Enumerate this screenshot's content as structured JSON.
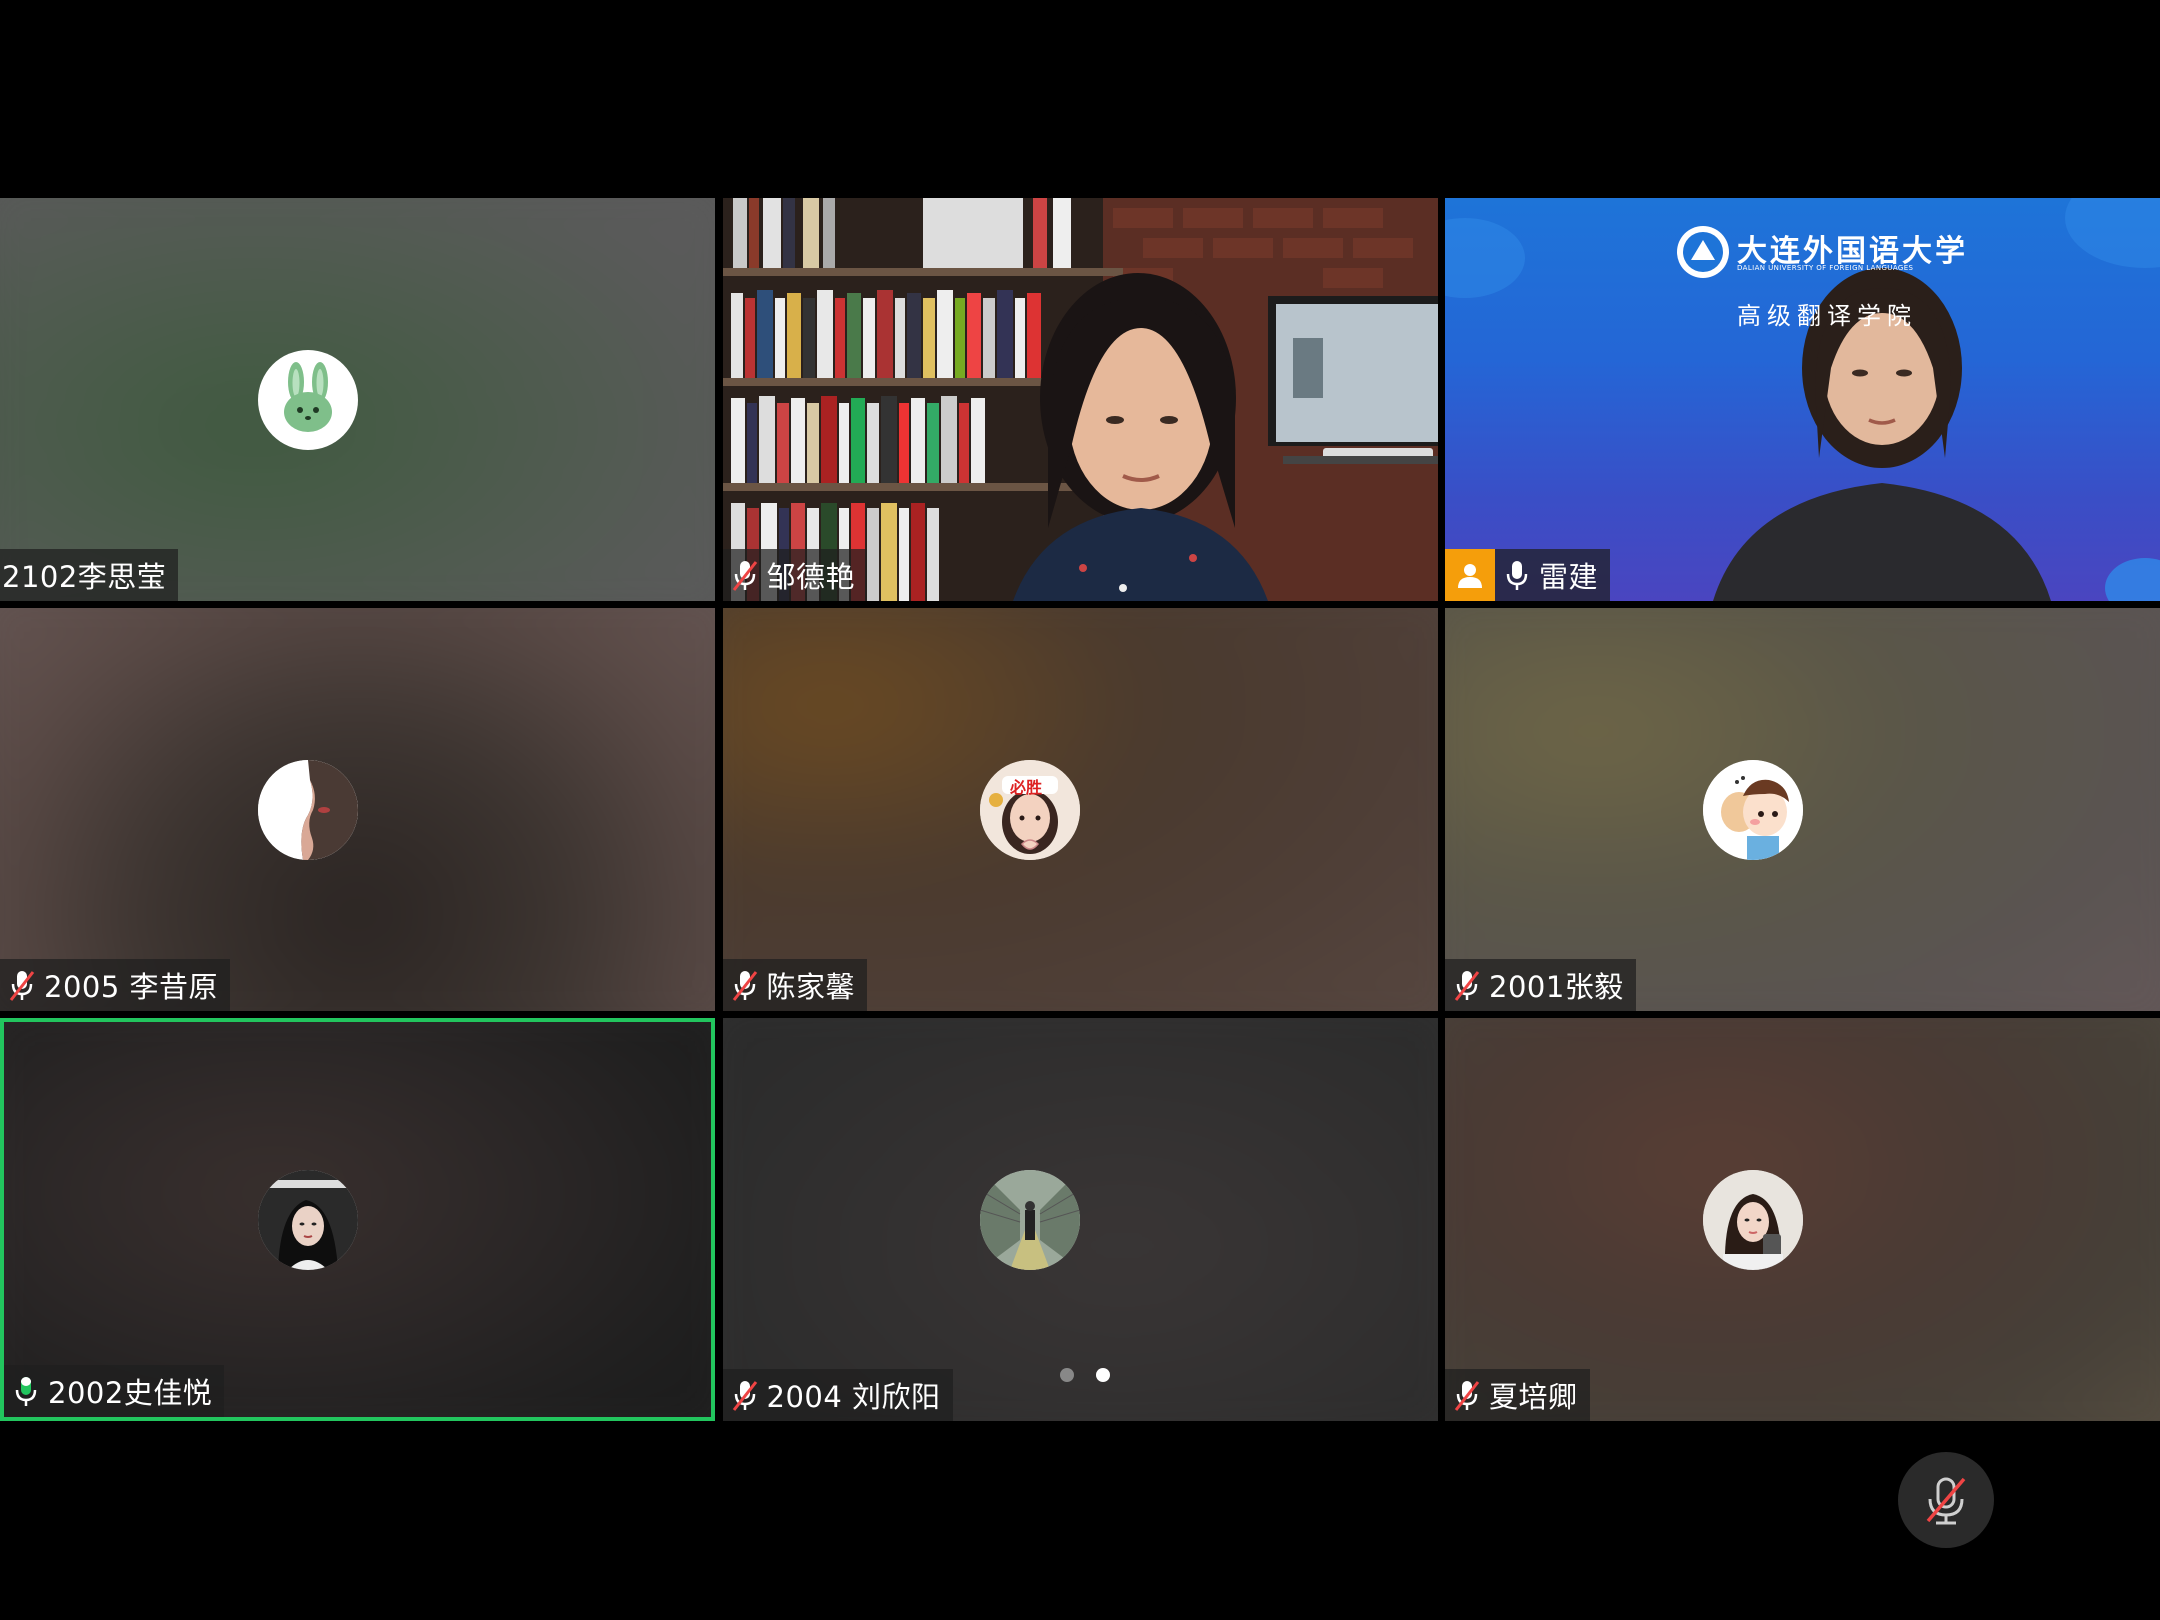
{
  "colors": {
    "active_speaker_border": "#22c55e",
    "host_badge": "#f59e0b",
    "muted_slash": "#ef4444"
  },
  "participants": [
    {
      "name": "2102李思莹",
      "mic": "none",
      "avatar": "rabbit-avatar"
    },
    {
      "name": "邹德艳",
      "mic": "muted",
      "video": "bookshelf-video"
    },
    {
      "name": "雷建",
      "mic": "on",
      "host": true,
      "video": "university-banner-video",
      "banner_title": "大连外国语大学",
      "banner_subtitle": "DALIAN UNIVERSITY OF FOREIGN LANGUAGES",
      "banner_college": "高级翻译学院"
    },
    {
      "name": "2005 李昔原",
      "mic": "muted",
      "avatar": "profile-avatar"
    },
    {
      "name": "陈家馨",
      "mic": "muted",
      "avatar": "girl-avatar",
      "avatar_caption": "必胜"
    },
    {
      "name": "2001张毅",
      "mic": "muted",
      "avatar": "cartoon-avatar"
    },
    {
      "name": "2002史佳悦",
      "mic": "on",
      "avatar": "portrait-avatar",
      "active": true
    },
    {
      "name": "2004 刘欣阳",
      "mic": "muted",
      "avatar": "walkway-avatar"
    },
    {
      "name": "夏培卿",
      "mic": "muted",
      "avatar": "selfie-avatar"
    }
  ],
  "pagination": {
    "pages": 2,
    "current": 2
  },
  "controls": {
    "mute_button": "mic-muted-icon"
  }
}
